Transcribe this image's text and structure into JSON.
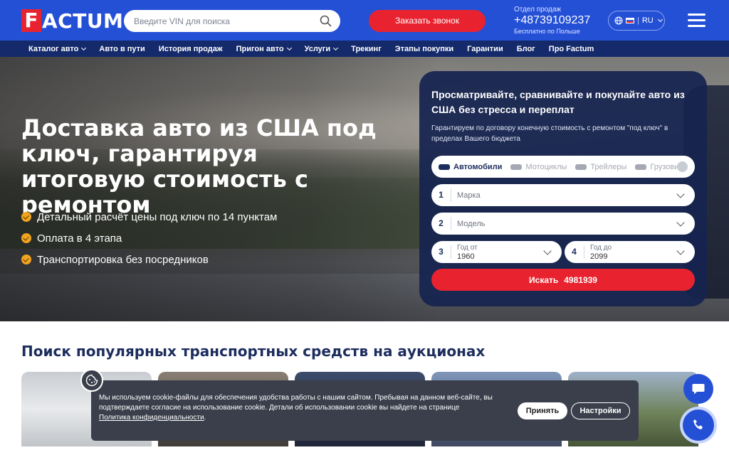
{
  "header": {
    "logo_mark": "F",
    "logo_text": "ACTUM",
    "search_placeholder": "Введите VIN для поиска",
    "callback_label": "Заказать звонок",
    "sales_dept": "Отдел продаж",
    "phone": "+48739109237",
    "phone_note": "Бесплатно по Польше",
    "lang": "RU"
  },
  "nav": {
    "items": [
      {
        "label": "Каталог авто",
        "dropdown": true
      },
      {
        "label": "Авто в пути",
        "dropdown": false
      },
      {
        "label": "История продаж",
        "dropdown": false
      },
      {
        "label": "Пригон авто",
        "dropdown": true
      },
      {
        "label": "Услуги",
        "dropdown": true
      },
      {
        "label": "Трекинг",
        "dropdown": false
      },
      {
        "label": "Этапы покупки",
        "dropdown": false
      },
      {
        "label": "Гарантии",
        "dropdown": false
      },
      {
        "label": "Блог",
        "dropdown": false
      },
      {
        "label": "Про Factum",
        "dropdown": false
      }
    ]
  },
  "hero": {
    "title": "Доставка авто из США под ключ, гарантируя итоговую стоимость с ремонтом",
    "bullets": [
      "Детальный расчёт цены под ключ по 14 пунктам",
      "Оплата в 4 этапа",
      "Транспортировка без посредников"
    ]
  },
  "search_panel": {
    "title": "Просматривайте, сравнивайте и покупайте авто из США без стресса и переплат",
    "subtitle": "Гарантируем по договору конечную стоимость с ремонтом \"под ключ\" в пределах Вашего бюджета",
    "tabs": [
      "Автомобили",
      "Мотоциклы",
      "Трейлеры",
      "Грузовики"
    ],
    "active_tab": "Автомобили",
    "make": {
      "num": "1",
      "label": "Марка"
    },
    "model": {
      "num": "2",
      "label": "Модель"
    },
    "year_from": {
      "num": "3",
      "label": "Год от",
      "value": "1960"
    },
    "year_to": {
      "num": "4",
      "label": "Год до",
      "value": "2099"
    },
    "search_label": "Искать",
    "search_count": "4981939"
  },
  "section": {
    "title": "Поиск популярных транспортных средств на аукционах"
  },
  "cookie": {
    "text": "Мы используем cookie-файлы для обеспечения удобства работы с нашим сайтом. Пребывая на данном веб-сайте, вы подтверждаете согласие на использование cookie. Детали об использовании cookie вы найдете на странице",
    "link": "Политика конфиденциальности",
    "link_suffix": ".",
    "accept": "Принять",
    "settings": "Настройки"
  },
  "colors": {
    "brand_blue": "#2450d6",
    "nav_dark": "#152a6b",
    "accent_red": "#e8232f",
    "check_orange": "#f0a420",
    "panel_navy": "#162450"
  },
  "icons": {
    "search": "search-icon",
    "globe": "globe-icon",
    "menu": "burger-menu-icon",
    "chat": "chat-icon",
    "phone": "phone-icon",
    "cookie": "cookie-icon"
  }
}
